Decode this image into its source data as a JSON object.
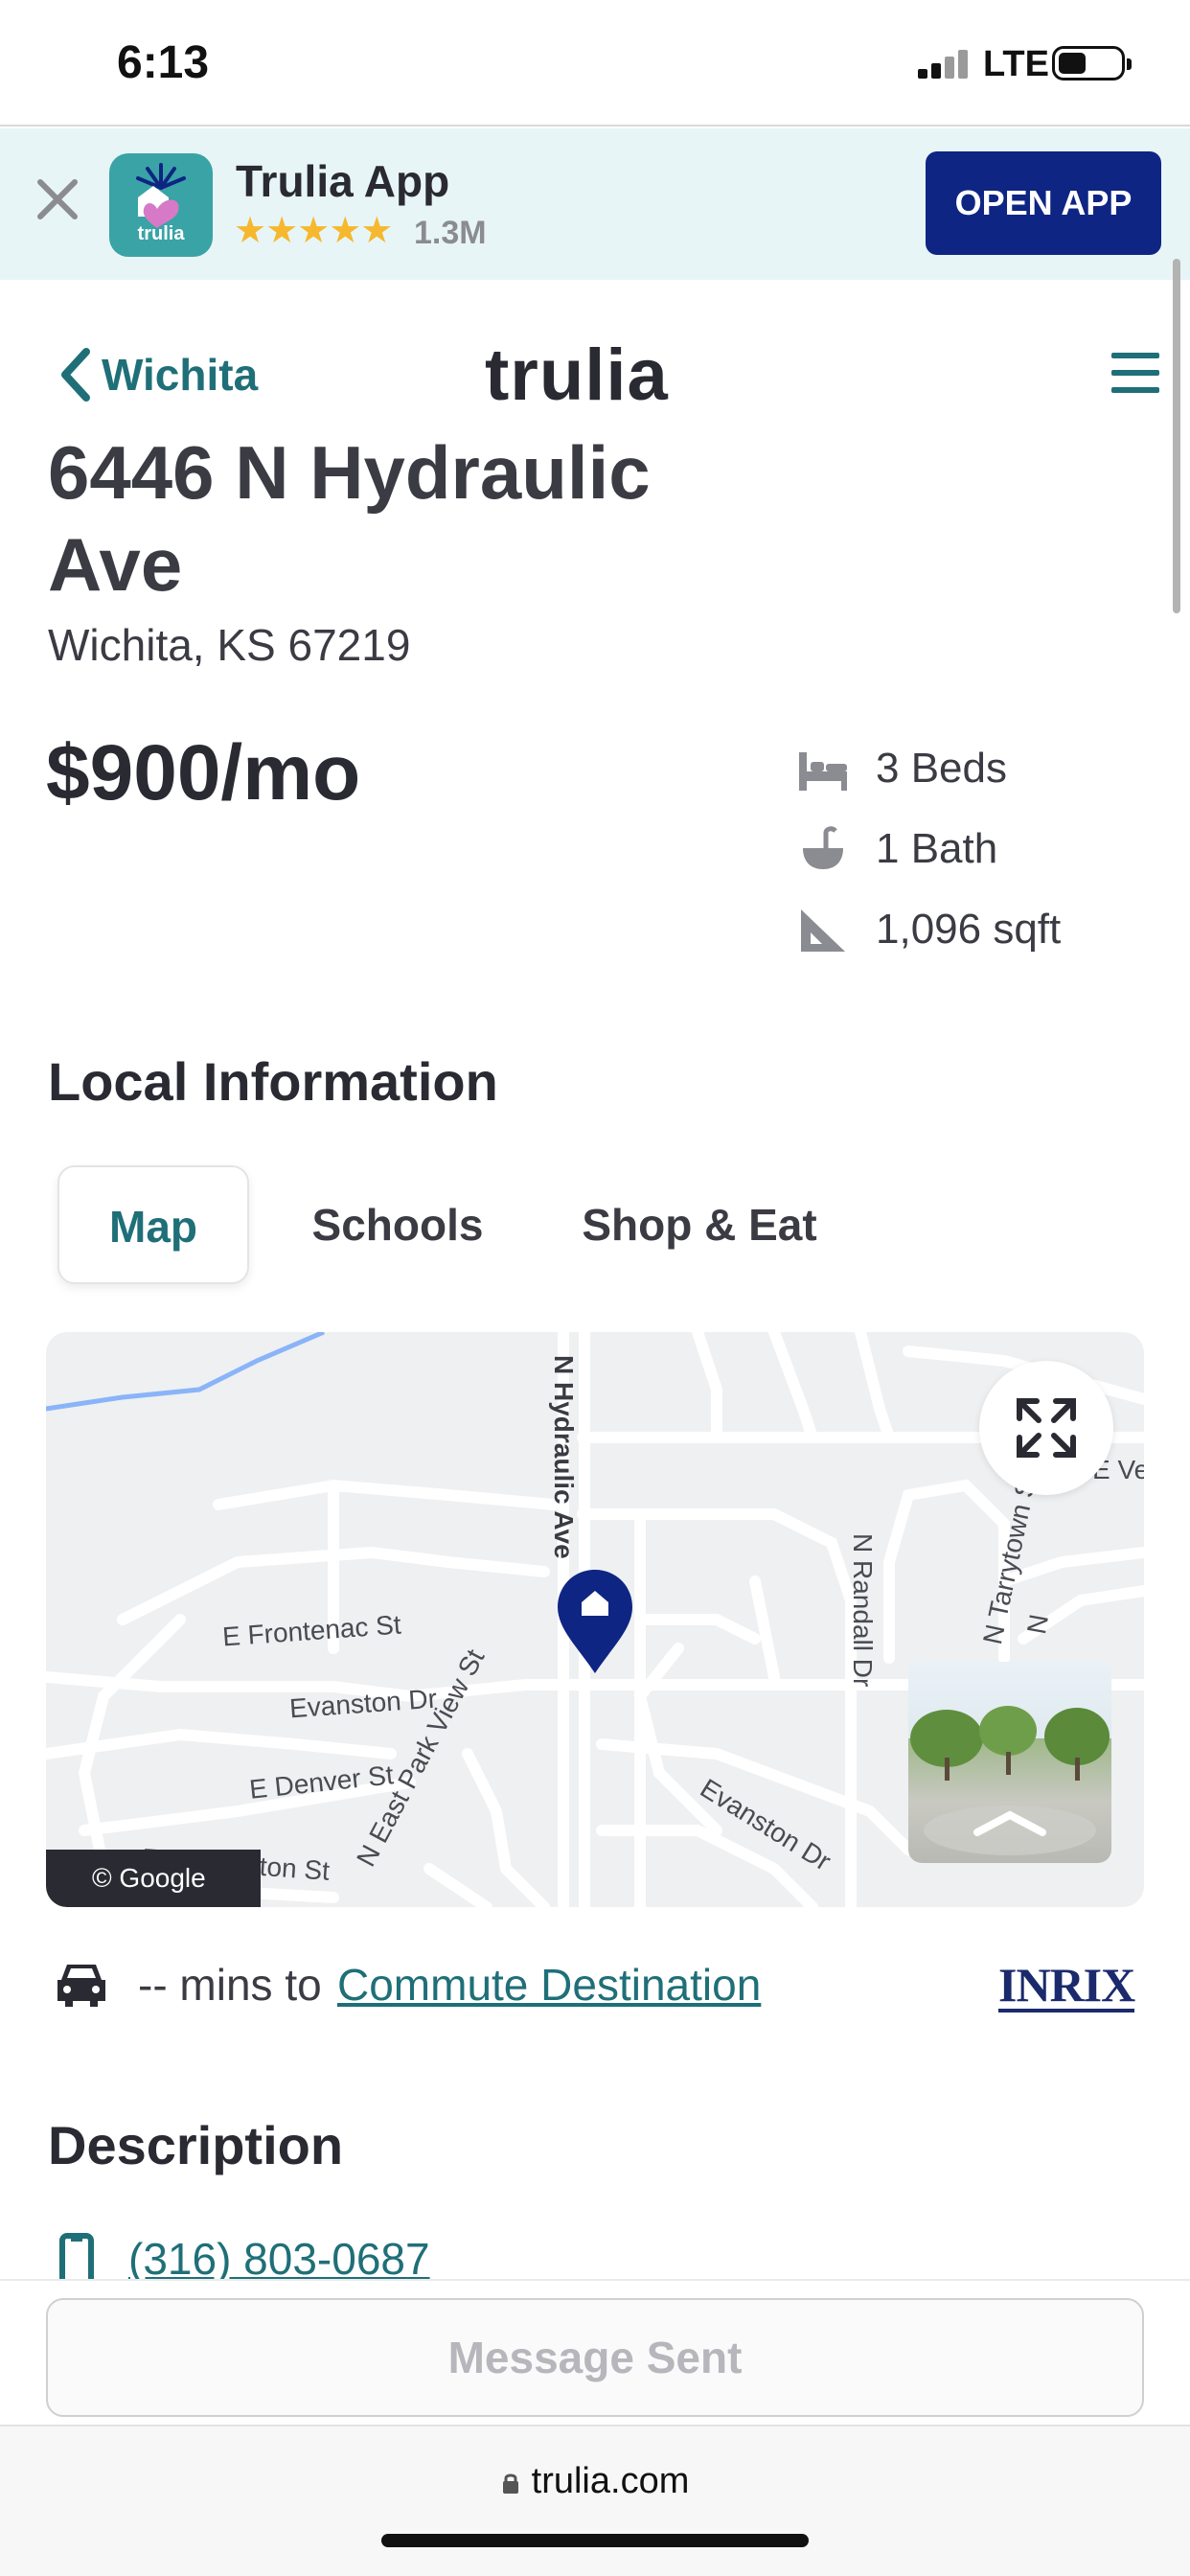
{
  "status_bar": {
    "time": "6:13",
    "carrier": "LTE"
  },
  "app_banner": {
    "app_name": "Trulia App",
    "icon_label": "trulia",
    "stars": "★★★★★",
    "rating_count": "1.3M",
    "open_label": "OPEN APP"
  },
  "header": {
    "back_label": "Wichita",
    "logo": "trulia"
  },
  "listing": {
    "address_line1": "6446 N Hydraulic",
    "address_line2": "Ave",
    "city_line": "Wichita, KS 67219",
    "price": "$900/mo",
    "beds": "3 Beds",
    "baths": "1 Bath",
    "sqft": "1,096 sqft"
  },
  "local_info": {
    "heading": "Local Information",
    "tabs": [
      {
        "label": "Map",
        "active": true
      },
      {
        "label": "Schools",
        "active": false
      },
      {
        "label": "Shop & Eat",
        "active": false
      }
    ]
  },
  "map": {
    "streets": {
      "hydraulic": "N Hydraulic Ave",
      "frontenac": "E Frontenac St",
      "evanston_w": "Evanston Dr",
      "denver": "E Denver St",
      "east_park": "N East Park View St",
      "charleston": "E Charleston St",
      "randall": "N Randall Dr",
      "tarrytown": "N Tarrytown St",
      "evanston_e": "Evanston Dr",
      "edge_e": "E Ve",
      "edge_n": "N"
    },
    "attribution": "© Google",
    "accent_color": "#0e2583"
  },
  "commute": {
    "mins": "-- mins to",
    "link": "Commute Destination",
    "provider": "INRIX"
  },
  "description": {
    "heading": "Description",
    "phone": "(316) 803-0687"
  },
  "sticky": {
    "message_button": "Message Sent"
  },
  "browser": {
    "url": "trulia.com"
  }
}
